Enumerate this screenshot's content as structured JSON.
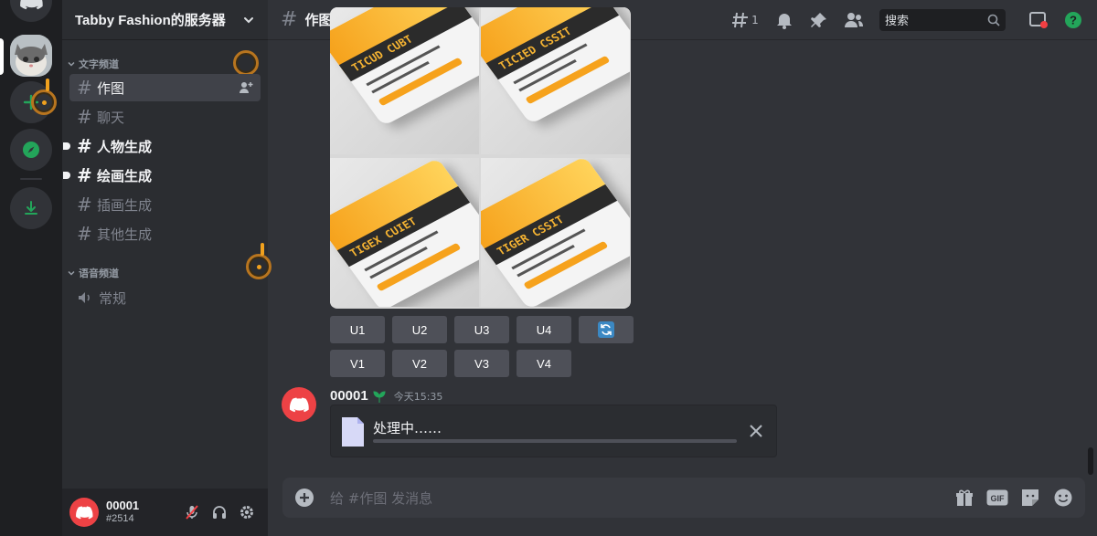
{
  "server": {
    "name": "Tabby Fashion的服务器"
  },
  "categories": {
    "text": "文字频道",
    "voice": "语音频道"
  },
  "channels": [
    {
      "name": "作图",
      "state": "active"
    },
    {
      "name": "聊天",
      "state": "muted"
    },
    {
      "name": "人物生成",
      "state": "unread"
    },
    {
      "name": "绘画生成",
      "state": "unread"
    },
    {
      "name": "插画生成",
      "state": "muted"
    },
    {
      "name": "其他生成",
      "state": "muted"
    }
  ],
  "voice_channels": [
    {
      "name": "常规"
    }
  ],
  "user": {
    "name": "00001",
    "tag": "#2514"
  },
  "header": {
    "channel": "作图",
    "threads_count": "1",
    "search_placeholder": "搜索"
  },
  "image_grid": {
    "tickets": [
      "TICUD CUBT",
      "TICIED CSSIT",
      "TIGEX CUIET",
      "TIGER CSSIT"
    ]
  },
  "buttons": {
    "upscale": [
      "U1",
      "U2",
      "U3",
      "U4"
    ],
    "variation": [
      "V1",
      "V2",
      "V3",
      "V4"
    ],
    "reroll_icon": "reroll-icon"
  },
  "message": {
    "author": "00001",
    "timestamp": "今天15:35",
    "attachment_status": "处理中……",
    "progress": 0.0
  },
  "composer": {
    "placeholder": "给 #作图 发消息"
  },
  "colors": {
    "accent": "#5865f2",
    "danger": "#ed4245",
    "online": "#23a55a"
  }
}
